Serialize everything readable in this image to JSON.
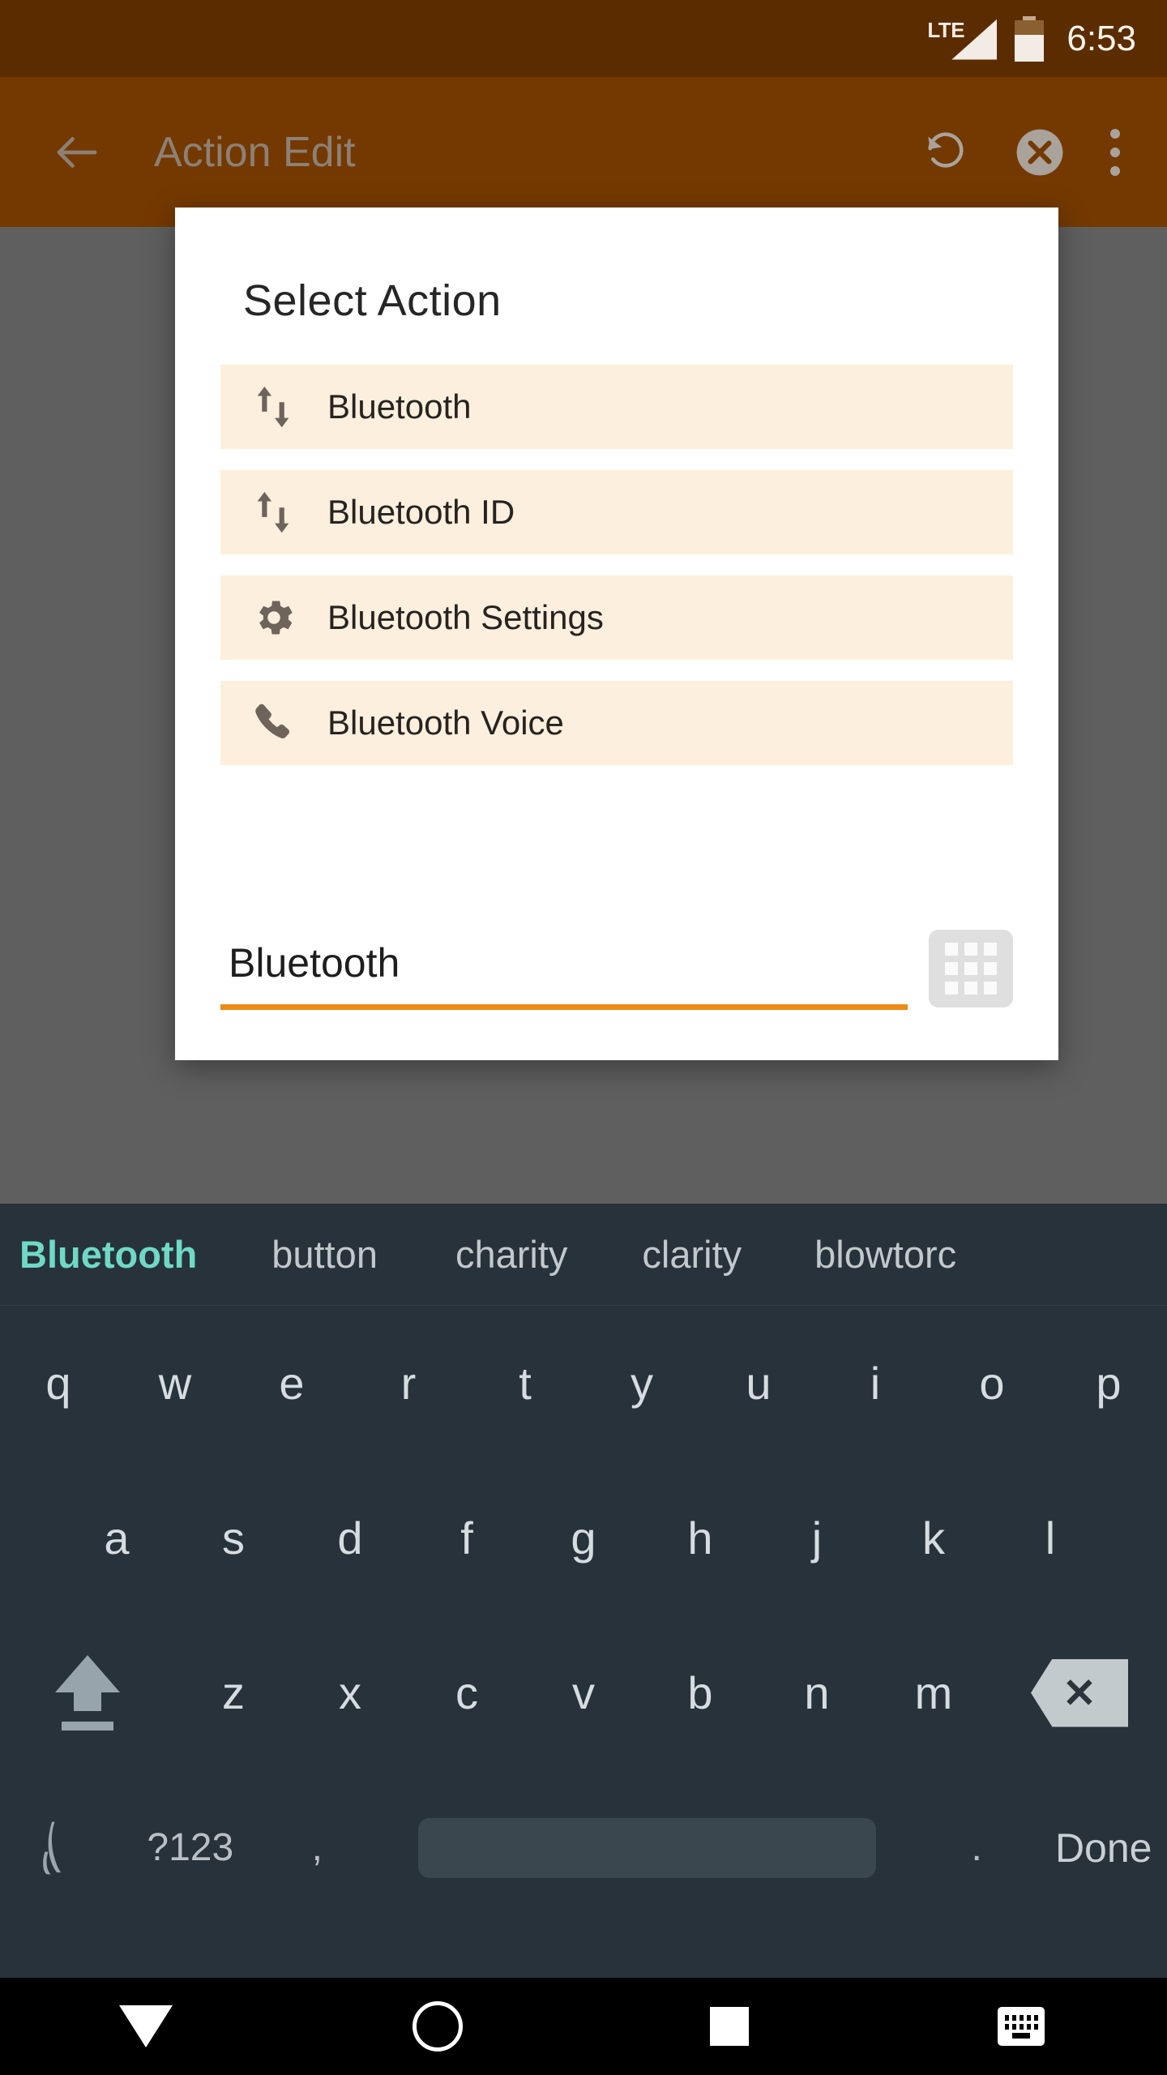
{
  "status_bar": {
    "network_label": "LTE",
    "time": "6:53",
    "signal_icon": "signal-triangle-icon",
    "battery_icon": "battery-icon"
  },
  "app_bar": {
    "title": "Action Edit",
    "back_icon": "back-arrow-icon",
    "undo_icon": "undo-rotate-icon",
    "clear_icon": "clear-circle-x-icon",
    "overflow_icon": "overflow-menu-icon"
  },
  "dialog": {
    "title": "Select  Action",
    "items": [
      {
        "label": "Bluetooth",
        "icon": "up-down-arrows-icon"
      },
      {
        "label": "Bluetooth ID",
        "icon": "up-down-arrows-icon"
      },
      {
        "label": "Bluetooth Settings",
        "icon": "gear-icon"
      },
      {
        "label": "Bluetooth Voice",
        "icon": "phone-handset-icon"
      }
    ],
    "input": {
      "value": "Bluetooth",
      "placeholder": "",
      "underline_color": "#ed8b16"
    },
    "grid_button_icon": "apps-grid-icon"
  },
  "keyboard": {
    "suggestions": [
      "Bluetooth",
      "button",
      "charity",
      "clarity",
      "blowtorc"
    ],
    "active_suggestion_index": 0,
    "active_suggestion_color": "#6fd9c6",
    "row1": [
      "q",
      "w",
      "e",
      "r",
      "t",
      "y",
      "u",
      "i",
      "o",
      "p"
    ],
    "row2": [
      "a",
      "s",
      "d",
      "f",
      "g",
      "h",
      "j",
      "k",
      "l"
    ],
    "row3": [
      "z",
      "x",
      "c",
      "v",
      "b",
      "n",
      "m"
    ],
    "shift_icon": "shift-arrow-icon",
    "backspace_icon": "backspace-icon",
    "row4": {
      "gesture_icon": "handwriting-gesture-icon",
      "symbols_label": "?123",
      "comma_label": ",",
      "space_label": "",
      "period_label": ".",
      "done_label": "Done"
    }
  },
  "nav_bar": {
    "back_icon": "hide-keyboard-down-icon",
    "home_icon": "home-circle-icon",
    "recents_icon": "recents-square-icon",
    "keyboard_switch_icon": "keyboard-switch-icon"
  },
  "colors": {
    "status_bar_bg": "#5b2c00",
    "app_bar_bg": "#733900",
    "scrim": "#5f5f5f",
    "dialog_bg": "#ffffff",
    "list_item_bg": "#fcefdd",
    "accent_orange": "#ed8b16",
    "keyboard_bg": "#28323a",
    "nav_bar_bg": "#000000"
  }
}
